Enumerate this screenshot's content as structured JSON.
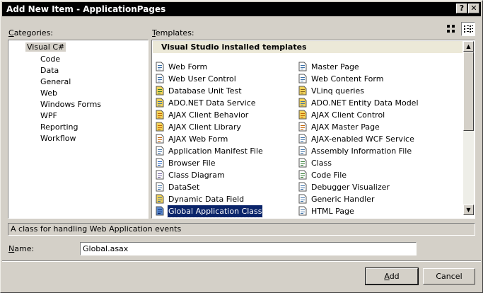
{
  "window": {
    "title": "Add New Item - ApplicationPages",
    "help_btn": "?",
    "close_btn": "✕"
  },
  "categories": {
    "label_underlined": "C",
    "label_rest": "ategories:",
    "items": [
      {
        "label": "Visual C#",
        "level": 0,
        "selected": true
      },
      {
        "label": "Code",
        "level": 1
      },
      {
        "label": "Data",
        "level": 1
      },
      {
        "label": "General",
        "level": 1
      },
      {
        "label": "Web",
        "level": 1
      },
      {
        "label": "Windows Forms",
        "level": 1
      },
      {
        "label": "WPF",
        "level": 1
      },
      {
        "label": "Reporting",
        "level": 1
      },
      {
        "label": "Workflow",
        "level": 1
      }
    ]
  },
  "templates": {
    "label_underlined": "T",
    "label_rest": "emplates:",
    "group_header": "Visual Studio installed templates",
    "left": [
      {
        "label": "Web Form",
        "icon": "web-form-icon"
      },
      {
        "label": "Web User Control",
        "icon": "web-user-control-icon"
      },
      {
        "label": "Database Unit Test",
        "icon": "database-unit-test-icon"
      },
      {
        "label": "ADO.NET Data Service",
        "icon": "data-service-icon"
      },
      {
        "label": "AJAX Client Behavior",
        "icon": "ajax-client-behavior-icon"
      },
      {
        "label": "AJAX Client Library",
        "icon": "ajax-client-library-icon"
      },
      {
        "label": "AJAX Web Form",
        "icon": "ajax-web-form-icon"
      },
      {
        "label": "Application Manifest File",
        "icon": "manifest-file-icon"
      },
      {
        "label": "Browser File",
        "icon": "browser-file-icon"
      },
      {
        "label": "Class Diagram",
        "icon": "class-diagram-icon"
      },
      {
        "label": "DataSet",
        "icon": "dataset-icon"
      },
      {
        "label": "Dynamic Data Field",
        "icon": "dynamic-data-field-icon"
      },
      {
        "label": "Global Application Class",
        "icon": "global-application-class-icon",
        "selected": true
      }
    ],
    "right": [
      {
        "label": "Master Page",
        "icon": "master-page-icon"
      },
      {
        "label": "Web Content Form",
        "icon": "web-content-form-icon"
      },
      {
        "label": "VLinq queries",
        "icon": "vlinq-queries-icon"
      },
      {
        "label": "ADO.NET Entity Data Model",
        "icon": "entity-data-model-icon"
      },
      {
        "label": "AJAX Client Control",
        "icon": "ajax-client-control-icon"
      },
      {
        "label": "AJAX Master Page",
        "icon": "ajax-master-page-icon"
      },
      {
        "label": "AJAX-enabled WCF Service",
        "icon": "wcf-service-icon"
      },
      {
        "label": "Assembly Information File",
        "icon": "assembly-info-icon"
      },
      {
        "label": "Class",
        "icon": "class-icon"
      },
      {
        "label": "Code File",
        "icon": "code-file-icon"
      },
      {
        "label": "Debugger Visualizer",
        "icon": "debugger-visualizer-icon"
      },
      {
        "label": "Generic Handler",
        "icon": "generic-handler-icon"
      },
      {
        "label": "HTML Page",
        "icon": "html-page-icon"
      }
    ]
  },
  "description": "A class for handling Web Application events",
  "name_field": {
    "label_underlined": "N",
    "label_rest": "ame:",
    "value": "Global.asax"
  },
  "buttons": {
    "add_underlined": "A",
    "add_rest": "dd",
    "cancel": "Cancel"
  },
  "view": {
    "large_icons": "large-icons-view-icon",
    "small_icons": "small-icons-view-icon",
    "selected": "small"
  }
}
